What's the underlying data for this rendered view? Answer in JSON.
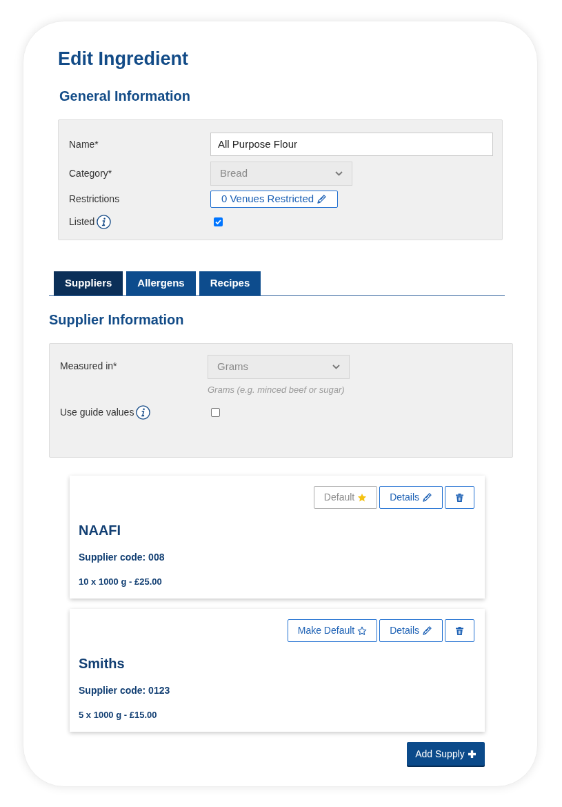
{
  "page": {
    "title": "Edit Ingredient"
  },
  "general": {
    "heading": "General Information",
    "fields": [
      {
        "kind": "text",
        "label": "Name*",
        "value": "All Purpose Flour"
      },
      {
        "kind": "select",
        "label": "Category*",
        "value": "Bread",
        "disabled": true
      },
      {
        "kind": "button",
        "label": "Restrictions",
        "value": "0 Venues Restricted"
      },
      {
        "kind": "checkbox",
        "label": "Listed",
        "info": true,
        "checked": true
      }
    ]
  },
  "tabs": [
    {
      "label": "Suppliers",
      "selected": true
    },
    {
      "label": "Allergens",
      "selected": false
    },
    {
      "label": "Recipes",
      "selected": false
    }
  ],
  "supplier_info": {
    "heading": "Supplier Information",
    "fields": [
      {
        "kind": "select",
        "label": "Measured in*",
        "value": "Grams",
        "disabled": true,
        "hint": "Grams (e.g. minced beef or sugar)"
      },
      {
        "kind": "checkbox",
        "label": "Use guide values",
        "info": true,
        "checked": false
      }
    ]
  },
  "supplies": [
    {
      "name": "NAAFI",
      "code": "Supplier code: 008",
      "pack": "10 x 1000 g - £25.00",
      "is_default": true,
      "default_label": "Default",
      "details_label": "Details"
    },
    {
      "name": "Smiths",
      "code": "Supplier code: 0123",
      "pack": "5 x 1000 g - £15.00",
      "is_default": false,
      "default_label": "Make Default",
      "details_label": "Details"
    }
  ],
  "add_button": {
    "label": "Add Supply"
  }
}
